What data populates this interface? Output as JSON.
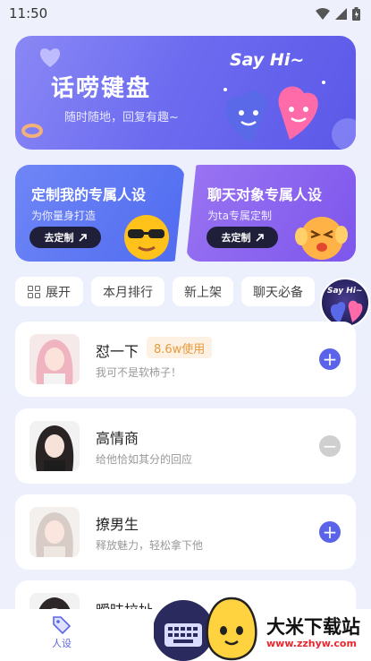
{
  "status_bar": {
    "time": "11:50"
  },
  "hero": {
    "title": "话唠键盘",
    "subtitle": "随时随地，回复有趣~",
    "tagline": "Say Hi~",
    "colors": {
      "start": "#8a88f5",
      "end": "#5b58e8"
    }
  },
  "promos": [
    {
      "title": "定制我的专属人设",
      "subtitle": "为你量身打造",
      "button": "去定制"
    },
    {
      "title": "聊天对象专属人设",
      "subtitle": "为ta专属定制",
      "button": "去定制"
    }
  ],
  "filters": {
    "expand_label": "展开",
    "tabs": [
      "本月排行",
      "新上架",
      "聊天必备"
    ]
  },
  "floating_badge": {
    "tagline": "Say Hi~"
  },
  "personas": [
    {
      "name": "怼一下",
      "usage": "8.6w使用",
      "description": "我可不是软柿子！",
      "action": "add"
    },
    {
      "name": "高情商",
      "usage": "",
      "description": "给他恰如其分的回应",
      "action": "remove"
    },
    {
      "name": "撩男生",
      "usage": "",
      "description": "释放魅力，轻松拿下他",
      "action": "add"
    },
    {
      "name": "暧昧拉扯",
      "usage": "",
      "description": "",
      "action": "add"
    }
  ],
  "bottom_nav": {
    "items": [
      {
        "label": "人设",
        "icon": "tag-icon",
        "active": true
      }
    ]
  },
  "watermark": {
    "title": "大米下载站",
    "url": "www.zzhyw.com"
  },
  "accent_color": "#5b63e8"
}
